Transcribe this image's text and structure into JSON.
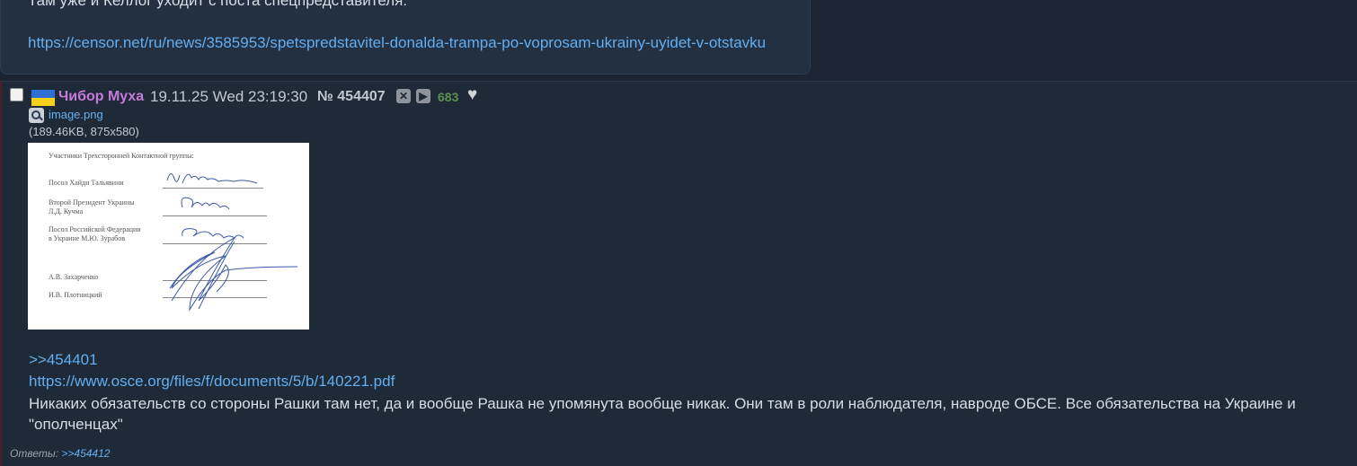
{
  "prev_post": {
    "text": "Там уже и Келлог уходит с поста спецпредставителя:",
    "link": "https://censor.net/ru/news/3585953/spetspredstavitel-donalda-trampa-po-voprosam-ukrainy-uyidet-v-otstavku"
  },
  "post": {
    "name": "Чибор Муха",
    "date": "19.11.25 Wed 23:19:30",
    "number": "№ 454407",
    "likes": "683",
    "file": {
      "name": "image.png",
      "info": "(189.46KB, 875x580)"
    },
    "thumb_text": {
      "header": "Участники Трехсторонней Контактной группы:",
      "line1": "Посол Хайди Тальявини",
      "line2a": "Второй Президент Украины",
      "line2b": "Л.Д. Кучма",
      "line3a": "Посол Российской Федерации",
      "line3b": "в Украине М.Ю. Зурабов",
      "line4": "А.В. Захарченко",
      "line5": "И.В. Плотницкий"
    },
    "reply_ref": ">>454401",
    "link": "https://www.osce.org/files/f/documents/5/b/140221.pdf",
    "body": "Никаких обязательств со стороны Рашки там нет, да и вообще Рашка не упомянута вообще никак. Они там в роли наблюдателя, навроде ОБСЕ. Все обязательства на Украине и \"ополченцах\"",
    "answers_label": "Ответы:",
    "answers_link": ">>454412"
  },
  "colors": {
    "background": "#1b2533",
    "link": "#63aef0",
    "name": "#c77bd8",
    "likes": "#5c8f4f"
  }
}
